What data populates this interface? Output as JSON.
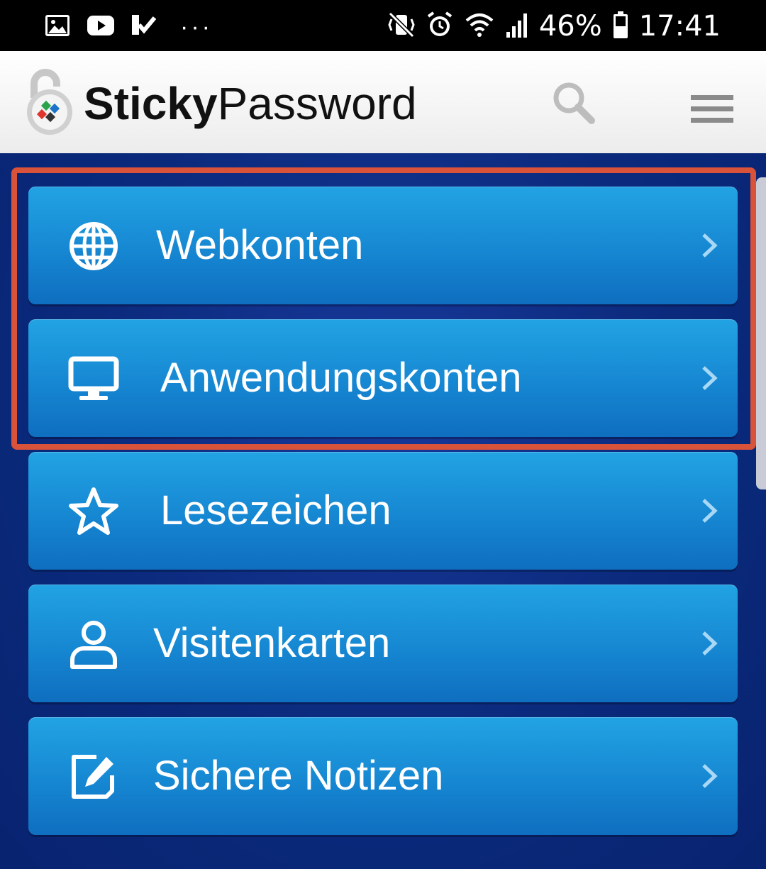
{
  "status_bar": {
    "battery_percent": "46%",
    "time": "17:41",
    "more_indicator": "···",
    "icons": [
      "gallery-icon",
      "youtube-icon",
      "tasks-icon",
      "vibrate-mute-icon",
      "alarm-icon",
      "wifi-icon",
      "signal-icon",
      "battery-icon"
    ]
  },
  "header": {
    "brand_bold": "Sticky",
    "brand_regular": "Password",
    "icons": [
      "stickypassword-logo",
      "search-icon",
      "hamburger-menu-icon"
    ]
  },
  "menu": {
    "items": [
      {
        "label": "Webkonten",
        "icon": "globe-icon"
      },
      {
        "label": "Anwendungskonten",
        "icon": "monitor-icon"
      },
      {
        "label": "Lesezeichen",
        "icon": "star-icon"
      },
      {
        "label": "Visitenkarten",
        "icon": "person-icon"
      },
      {
        "label": "Sichere Notizen",
        "icon": "note-edit-icon"
      }
    ]
  },
  "colors": {
    "background": "#0a2a7a",
    "item_top": "#22a3e3",
    "item_bottom": "#0f6ebf",
    "highlight": "#d9523a",
    "header_bg": "#ffffff"
  }
}
